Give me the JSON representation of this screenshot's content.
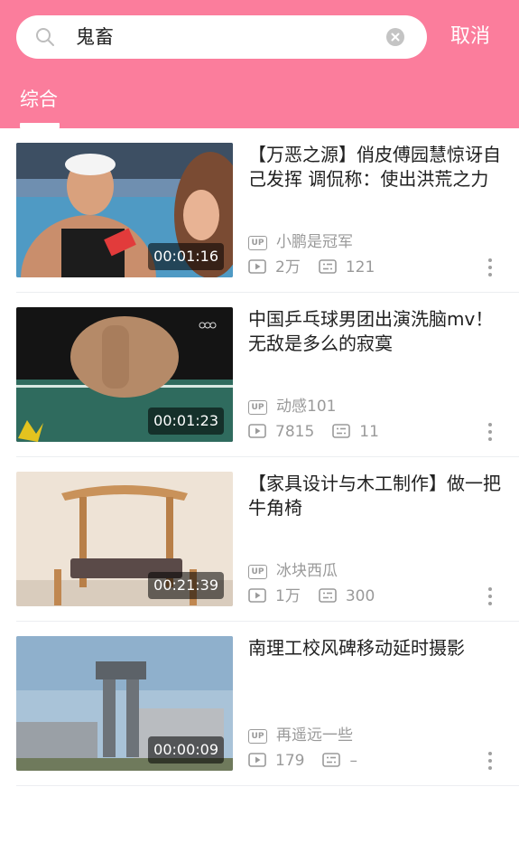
{
  "search": {
    "query": "鬼畜"
  },
  "cancel_label": "取消",
  "tabs": [
    {
      "label": "综合"
    }
  ],
  "colors": {
    "accent": "#fb7d9c",
    "meta_gray": "#9a9a9a"
  },
  "videos": [
    {
      "title": "【万恶之源】俏皮傅园慧惊讶自己发挥 调侃称：使出洪荒之力",
      "duration": "00:01:16",
      "uploader": "小鹏是冠军",
      "plays": "2万",
      "danmaku": "121",
      "thumb_icon": "swimmer-interview-thumbnail"
    },
    {
      "title": "中国乒乓球男团出演洗脑mv！无敌是多么的寂寞",
      "duration": "00:01:23",
      "uploader": "动感101",
      "plays": "7815",
      "danmaku": "11",
      "thumb_icon": "ping-pong-table-thumbnail"
    },
    {
      "title": "【家具设计与木工制作】做一把牛角椅",
      "duration": "00:21:39",
      "uploader": "冰块西瓜",
      "plays": "1万",
      "danmaku": "300",
      "thumb_icon": "wooden-chair-thumbnail"
    },
    {
      "title": "南理工校风碑移动延时摄影",
      "duration": "00:00:09",
      "uploader": "再遥远一些",
      "plays": "179",
      "danmaku": "–",
      "thumb_icon": "campus-tower-thumbnail"
    }
  ],
  "labels": {
    "up_badge": "UP"
  }
}
